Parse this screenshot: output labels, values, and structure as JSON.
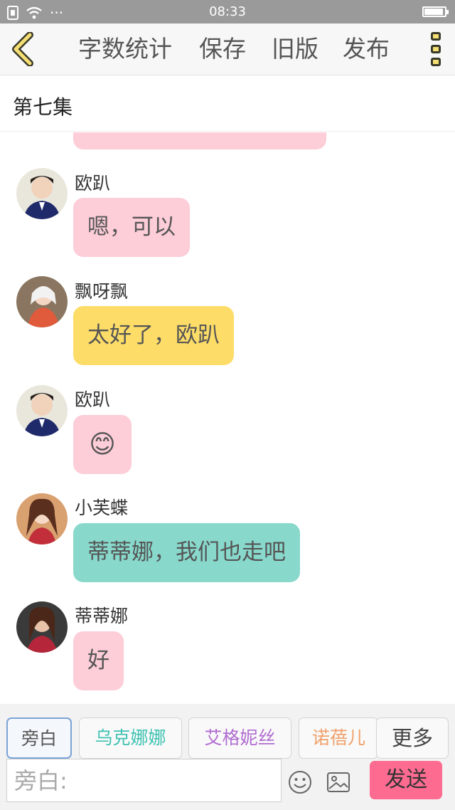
{
  "status_bar": {
    "time": "08:33",
    "dots": "···"
  },
  "toolbar": {
    "word_count": "字数统计",
    "save": "保存",
    "old_version": "旧版",
    "publish": "发布"
  },
  "episode": {
    "title": "第七集"
  },
  "chat": {
    "messages": [
      {
        "speaker": "欧趴",
        "text": "嗯，可以",
        "color": "#fdcdd8"
      },
      {
        "speaker": "飘呀飘",
        "text": "太好了，欧趴",
        "color": "#fddd68"
      },
      {
        "speaker": "欧趴",
        "text": "😊",
        "color": "#fdcdd8"
      },
      {
        "speaker": "小芙蝶",
        "text": "蒂蒂娜，我们也走吧",
        "color": "#88d9cc"
      },
      {
        "speaker": "蒂蒂娜",
        "text": "好",
        "color": "#fdcdd8"
      }
    ]
  },
  "characters": {
    "narrator": "旁白",
    "c1": "乌克娜娜",
    "c2": "艾格妮丝",
    "c3": "诺蓓儿",
    "more": "更多",
    "colors": {
      "c1": "#3fc2b2",
      "c2": "#b06cd0",
      "c3": "#f0a06a"
    }
  },
  "composer": {
    "placeholder": "旁白:",
    "send": "发送"
  },
  "icons": [
    "back-chevron-icon",
    "menu-icon",
    "emoji-icon",
    "image-icon",
    "wifi-icon",
    "sim-icon"
  ]
}
